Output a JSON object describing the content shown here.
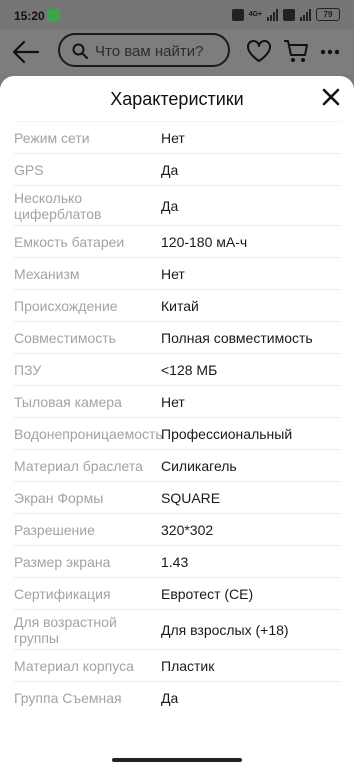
{
  "status_bar": {
    "time": "15:20",
    "network": "4G+",
    "battery": "79"
  },
  "header": {
    "search_placeholder": "Что вам найти?"
  },
  "sheet": {
    "title": "Характеристики",
    "rows": [
      {
        "label": "Режим сети",
        "value": "Нет"
      },
      {
        "label": "GPS",
        "value": "Да"
      },
      {
        "label": "Несколько циферблатов",
        "value": "Да"
      },
      {
        "label": "Емкость батареи",
        "value": "120-180 мА-ч"
      },
      {
        "label": "Механизм",
        "value": "Нет"
      },
      {
        "label": "Происхождение",
        "value": "Китай"
      },
      {
        "label": "Совместимость",
        "value": "Полная совместимость"
      },
      {
        "label": "ПЗУ",
        "value": "<128 МБ"
      },
      {
        "label": "Тыловая камера",
        "value": "Нет"
      },
      {
        "label": "Водонепроницаемость",
        "value": "Профессиональный"
      },
      {
        "label": "Материал браслета",
        "value": "Силикагель"
      },
      {
        "label": "Экран Формы",
        "value": "SQUARE"
      },
      {
        "label": "Разрешение",
        "value": "320*302"
      },
      {
        "label": "Размер экрана",
        "value": "1.43"
      },
      {
        "label": "Сертификация",
        "value": "Евротест (CE)"
      },
      {
        "label": "Для возрастной группы",
        "value": "Для взрослых (+18)"
      },
      {
        "label": "Материал корпуса",
        "value": "Пластик"
      },
      {
        "label": "Группа Съемная",
        "value": "Да"
      }
    ]
  },
  "icons": [
    "back-arrow-icon",
    "search-icon",
    "heart-icon",
    "cart-icon",
    "more-icon",
    "close-icon"
  ]
}
